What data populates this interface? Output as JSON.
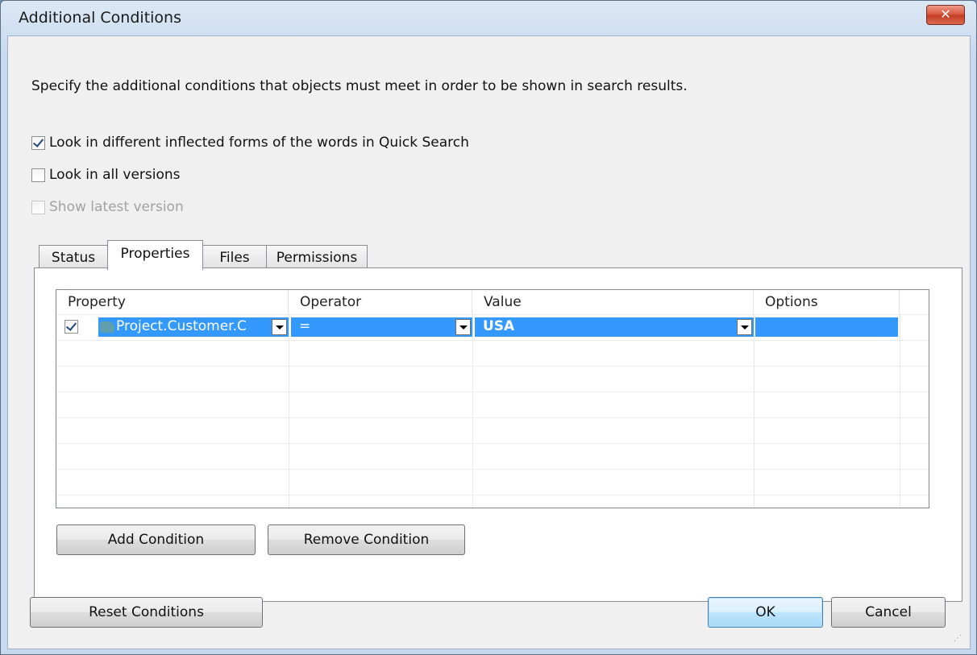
{
  "window": {
    "title": "Additional Conditions",
    "close_label": "✕"
  },
  "description": "Specify the additional conditions that objects must meet in order to be shown in search results.",
  "options": [
    {
      "label": "Look in different inflected forms of the words in Quick Search",
      "checked": true,
      "enabled": true
    },
    {
      "label": "Look in all versions",
      "checked": false,
      "enabled": true
    },
    {
      "label": "Show latest version",
      "checked": false,
      "enabled": false
    }
  ],
  "tabs": [
    {
      "label": "Status",
      "active": false
    },
    {
      "label": "Properties",
      "active": true
    },
    {
      "label": "Files",
      "active": false
    },
    {
      "label": "Permissions",
      "active": false
    }
  ],
  "grid": {
    "columns": [
      "Property",
      "Operator",
      "Value",
      "Options"
    ],
    "rows": [
      {
        "checked": true,
        "property": "Project.Customer.C",
        "operator": "=",
        "value": "USA",
        "options": ""
      }
    ]
  },
  "buttons": {
    "add_condition": "Add Condition",
    "remove_condition": "Remove Condition",
    "reset_conditions": "Reset Conditions",
    "ok": "OK",
    "cancel": "Cancel"
  },
  "colors": {
    "selection": "#3399ff",
    "close_button": "#c13a22"
  }
}
